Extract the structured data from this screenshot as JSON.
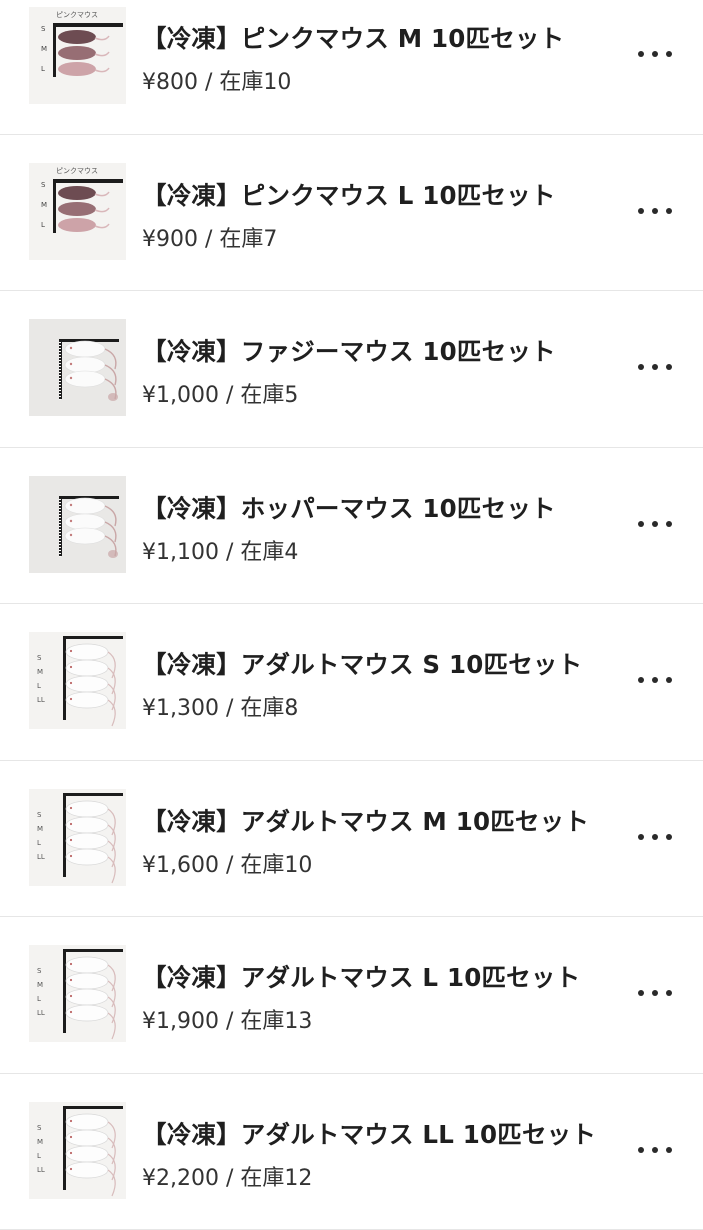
{
  "items": [
    {
      "title": "【冷凍】ピンクマウス M 10匹セット",
      "price": "¥800",
      "separator": " / ",
      "stock": "在庫10",
      "thumb_type": "pink",
      "thumb_heading": "ピンクマウス",
      "thumb_marks": [
        "S",
        "M",
        "L"
      ]
    },
    {
      "title": "【冷凍】ピンクマウス L 10匹セット",
      "price": "¥900",
      "separator": " / ",
      "stock": "在庫7",
      "thumb_type": "pink",
      "thumb_heading": "ピンクマウス",
      "thumb_marks": [
        "S",
        "M",
        "L"
      ]
    },
    {
      "title": "【冷凍】ファジーマウス 10匹セット",
      "price": "¥1,000",
      "separator": " / ",
      "stock": "在庫5",
      "thumb_type": "fuzzy",
      "thumb_heading": "",
      "thumb_marks": []
    },
    {
      "title": "【冷凍】ホッパーマウス 10匹セット",
      "price": "¥1,100",
      "separator": " / ",
      "stock": "在庫4",
      "thumb_type": "fuzzy",
      "thumb_heading": "",
      "thumb_marks": []
    },
    {
      "title": "【冷凍】アダルトマウス S 10匹セット",
      "price": "¥1,300",
      "separator": " / ",
      "stock": "在庫8",
      "thumb_type": "adult",
      "thumb_heading": "",
      "thumb_marks": [
        "S",
        "M",
        "L",
        "LL"
      ]
    },
    {
      "title": "【冷凍】アダルトマウス M 10匹セット",
      "price": "¥1,600",
      "separator": " / ",
      "stock": "在庫10",
      "thumb_type": "adult",
      "thumb_heading": "",
      "thumb_marks": [
        "S",
        "M",
        "L",
        "LL"
      ]
    },
    {
      "title": "【冷凍】アダルトマウス L 10匹セット",
      "price": "¥1,900",
      "separator": " / ",
      "stock": "在庫13",
      "thumb_type": "adult",
      "thumb_heading": "",
      "thumb_marks": [
        "S",
        "M",
        "L",
        "LL"
      ]
    },
    {
      "title": "【冷凍】アダルトマウス LL 10匹セット",
      "price": "¥2,200",
      "separator": " / ",
      "stock": "在庫12",
      "thumb_type": "adult",
      "thumb_heading": "",
      "thumb_marks": [
        "S",
        "M",
        "L",
        "LL"
      ]
    }
  ],
  "more_icon": "more-horizontal-icon",
  "colors": {
    "divider": "#e6e6e6",
    "title": "#1f1f1f",
    "subtitle": "#333333",
    "pink_mouse": "#caa3a6",
    "dark_mouse": "#7a4f55"
  }
}
